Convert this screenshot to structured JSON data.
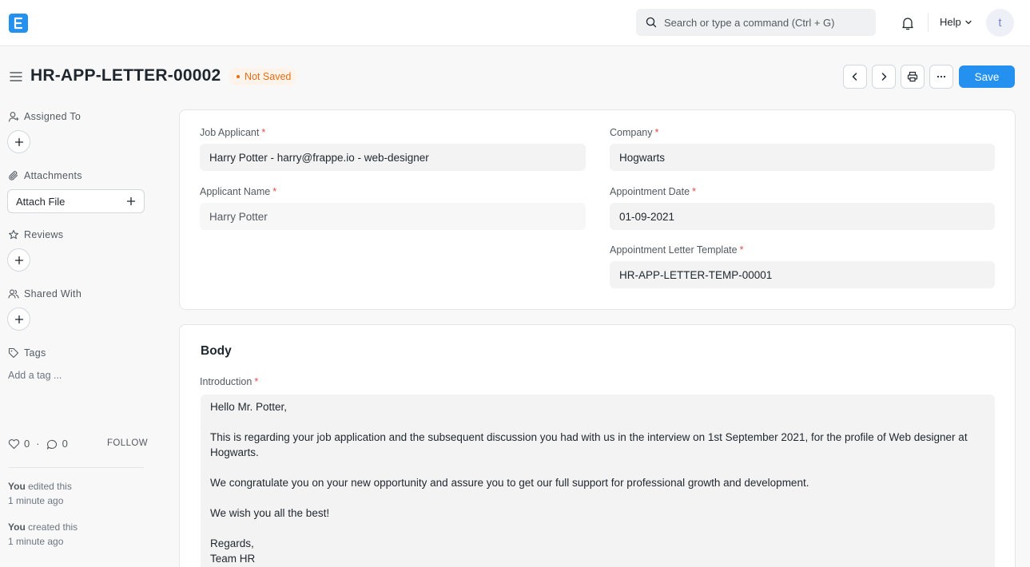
{
  "navbar": {
    "search_placeholder": "Search or type a command (Ctrl + G)",
    "help_label": "Help",
    "avatar_initial": "t"
  },
  "page": {
    "title": "HR-APP-LETTER-00002",
    "status": "Not Saved",
    "save_label": "Save"
  },
  "sidebar": {
    "assigned_to": "Assigned To",
    "attachments": "Attachments",
    "attach_file": "Attach File",
    "reviews": "Reviews",
    "shared_with": "Shared With",
    "tags": "Tags",
    "add_tag": "Add a tag ...",
    "likes_count": "0",
    "comments_count": "0",
    "separator": "·",
    "follow": "FOLLOW",
    "activity": [
      {
        "user": "You",
        "action": "edited this",
        "time": "1 minute ago"
      },
      {
        "user": "You",
        "action": "created this",
        "time": "1 minute ago"
      }
    ]
  },
  "form": {
    "job_applicant": {
      "label": "Job Applicant",
      "value": "Harry Potter - harry@frappe.io - web-designer"
    },
    "applicant_name": {
      "label": "Applicant Name",
      "value": "Harry Potter"
    },
    "company": {
      "label": "Company",
      "value": "Hogwarts"
    },
    "appointment_date": {
      "label": "Appointment Date",
      "value": "01-09-2021"
    },
    "template": {
      "label": "Appointment Letter Template",
      "value": "HR-APP-LETTER-TEMP-00001"
    },
    "required_mark": "*"
  },
  "body": {
    "section_title": "Body",
    "introduction_label": "Introduction",
    "lines": [
      "Hello Mr. Potter,",
      "This is regarding your job application and the subsequent discussion you had with us in the interview on 1st September 2021, for the profile of Web designer at Hogwarts.",
      "We congratulate you on your new opportunity and assure you to get our full support for professional growth and development.",
      "We wish you all the best!",
      "Regards,",
      "Team HR"
    ]
  },
  "colors": {
    "primary": "#2490ef",
    "not_saved": "#e86c13",
    "required": "#e24c4c"
  }
}
